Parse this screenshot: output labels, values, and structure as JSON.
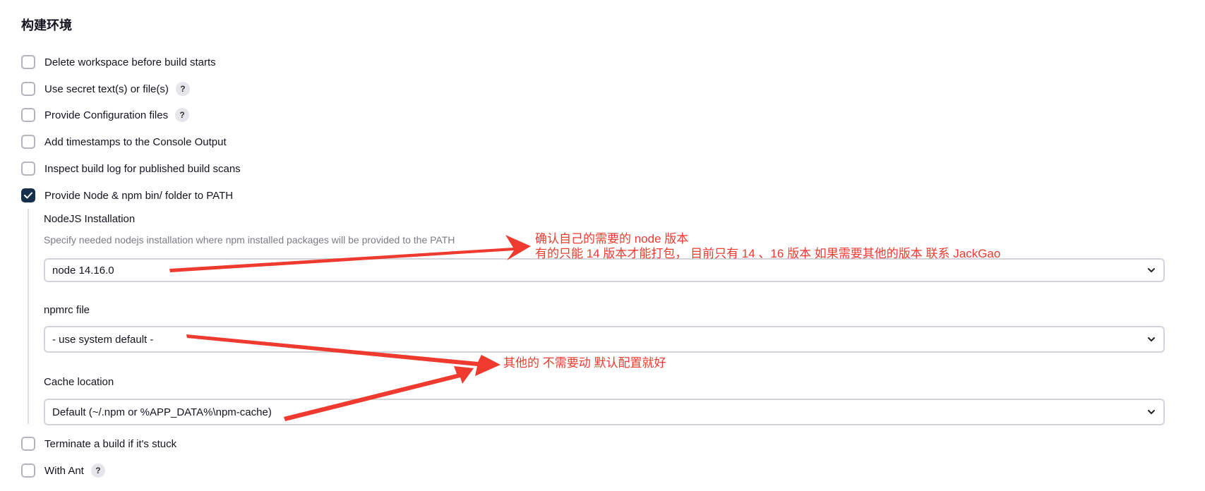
{
  "section": {
    "title": "构建环境"
  },
  "options": [
    {
      "label": "Delete workspace before build starts",
      "checked": false,
      "help": false
    },
    {
      "label": "Use secret text(s) or file(s)",
      "checked": false,
      "help": true
    },
    {
      "label": "Provide Configuration files",
      "checked": false,
      "help": true
    },
    {
      "label": "Add timestamps to the Console Output",
      "checked": false,
      "help": false
    },
    {
      "label": "Inspect build log for published build scans",
      "checked": false,
      "help": false
    },
    {
      "label": "Provide Node & npm bin/ folder to PATH",
      "checked": true,
      "help": false
    },
    {
      "label": "Terminate a build if it's stuck",
      "checked": false,
      "help": false
    },
    {
      "label": "With Ant",
      "checked": false,
      "help": true
    }
  ],
  "help_glyph": "?",
  "node_config": {
    "nodejs": {
      "label": "NodeJS Installation",
      "description": "Specify needed nodejs installation where npm installed packages will be provided to the PATH",
      "value": "node 14.16.0"
    },
    "npmrc": {
      "label": "npmrc file",
      "value": "- use system default -"
    },
    "cache": {
      "label": "Cache location",
      "value": "Default (~/.npm or %APP_DATA%\\npm-cache)"
    }
  },
  "annotations": {
    "note1_line1": "确认自己的需要的 node 版本",
    "note1_line2": "有的只能 14 版本才能打包， 目前只有 14 、16 版本 如果需要其他的版本 联系 JackGao",
    "note2": "其他的 不需要动 默认配置就好"
  },
  "icons": {
    "checkbox_check": "checkmark-icon",
    "select_chevron": "chevron-down-icon"
  },
  "colors": {
    "checked_box": "#15304d",
    "annotation_red": "#ee3a2f"
  }
}
